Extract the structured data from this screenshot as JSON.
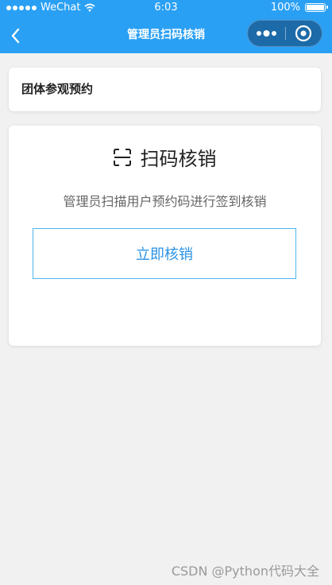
{
  "status_bar": {
    "carrier": "WeChat",
    "time": "6:03",
    "battery": "100%"
  },
  "nav": {
    "title": "管理员扫码核销",
    "back_icon": "chevron-left-icon",
    "more_icon": "more-dots-icon",
    "close_icon": "target-close-icon"
  },
  "section": {
    "title": "团体参观预约"
  },
  "scan_card": {
    "icon": "scan-icon",
    "title": "扫码核销",
    "description": "管理员扫描用户预约码进行签到核销",
    "button_label": "立即核销"
  },
  "watermark": "CSDN @Python代码大全",
  "colors": {
    "header": "#2aa0f5",
    "accent": "#2b93e6",
    "button_border": "#4fb6ee",
    "background": "#f1f1f1"
  }
}
